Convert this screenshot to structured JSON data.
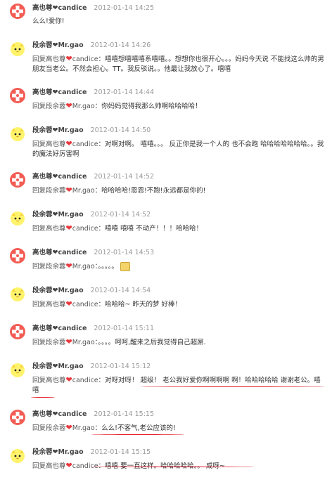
{
  "users": {
    "a": "高也尊❤candice",
    "b": "段余蓉❤Mr.gao"
  },
  "messages": [
    {
      "avatar": "cross-avatar",
      "name": "高也尊❤candice",
      "time": "2012-01-14 14:25",
      "text": "么么!爱你!"
    },
    {
      "avatar": "chick-avatar",
      "name": "段余蓉❤Mr.gao",
      "time": "2012-01-14 14:26",
      "reply_label": "回复高也尊",
      "reply_target": "candice",
      "text": "：嘻嘻想嘻嘻嘻系嘻嘻。。想想你也很开心。。。妈妈今天说 不能找这么帅的男朋友当老公。不然会担心。TT。我反驳说。。他最让我放心了。嘻嘻"
    },
    {
      "avatar": "cross-avatar",
      "name": "高也尊❤candice",
      "time": "2012-01-14 14:44",
      "reply_label": "回复段余蓉",
      "reply_target": "Mr.gao",
      "text": "：你妈妈觉得我那么帅啊哈哈哈哈！"
    },
    {
      "avatar": "chick-avatar",
      "name": "段余蓉❤Mr.gao",
      "time": "2012-01-14 14:50",
      "reply_label": "回复高也尊",
      "reply_target": "candice",
      "text": "：对啊对啊。 嘻嘻。。。 反正你是我一个人的 也不会跑 哈哈哈哈哈哈哈。。我的魔法好厉害啊"
    },
    {
      "avatar": "cross-avatar",
      "name": "高也尊❤candice",
      "time": "2012-01-14 14:52",
      "reply_label": "回复段余蓉",
      "reply_target": "Mr.gao",
      "text": "：哈哈哈哈!恩恩!不跑!永远都是你的!"
    },
    {
      "avatar": "chick-avatar",
      "name": "段余蓉❤Mr.gao",
      "time": "2012-01-14 14:52",
      "reply_label": "回复高也尊",
      "reply_target": "candice",
      "text": "：嘻嘻 嘻嘻 不动产！！！哈哈哈！"
    },
    {
      "avatar": "cross-avatar",
      "name": "高也尊❤candice",
      "time": "2012-01-14 14:53",
      "reply_label": "回复段余蓉",
      "reply_target": "Mr.gao",
      "text": "：。。。。。",
      "sticker": true
    },
    {
      "avatar": "chick-avatar",
      "name": "段余蓉❤Mr.gao",
      "time": "2012-01-14 14:54",
      "reply_label": "回复高也尊",
      "reply_target": "candice",
      "text": "：哈哈哈~ 昨天的梦 好棒！"
    },
    {
      "avatar": "cross-avatar",
      "name": "高也尊❤candice",
      "time": "2012-01-14 15:11",
      "reply_label": "回复段余蓉",
      "reply_target": "Mr.gao",
      "text": "：。。。。呵呵,醒来之后我觉得自己超屌."
    },
    {
      "avatar": "chick-avatar",
      "name": "段余蓉❤Mr.gao",
      "time": "2012-01-14 15:12",
      "reply_label": "回复高也尊",
      "reply_target": "candice",
      "text": "：对呀对呀！ 超级！ 老公我好爱你啊啊啊啊 啊！哈哈哈哈哈 谢谢老公。嘻嘻"
    },
    {
      "avatar": "cross-avatar",
      "name": "高也尊❤candice",
      "time": "2012-01-14 15:15",
      "reply_label": "回复段余蓉",
      "reply_target": "Mr.gao",
      "text": "：么么!不客气,老公应该的!"
    },
    {
      "avatar": "chick-avatar",
      "name": "段余蓉❤Mr.gao",
      "time": "2012-01-14 15:15",
      "reply_label": "回复高也尊",
      "reply_target": "candice",
      "text": "：嘻嘻 要一直这样。哈哈哈哈哈。。 成呀~"
    }
  ],
  "colors": {
    "underline": "#e51d2a",
    "heart": "#e8383d",
    "time": "#9a9a9a"
  }
}
